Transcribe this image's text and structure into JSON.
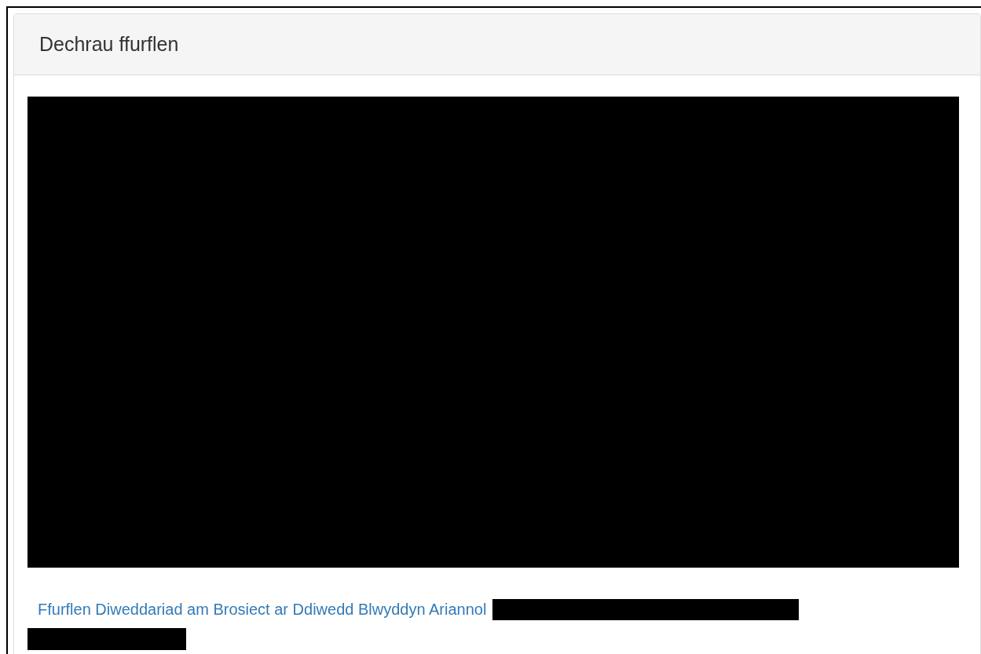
{
  "panel": {
    "title": "Dechrau ffurflen",
    "link": "Ffurflen Diweddariad am Brosiect ar Ddiwedd Blwyddyn Ariannol"
  }
}
